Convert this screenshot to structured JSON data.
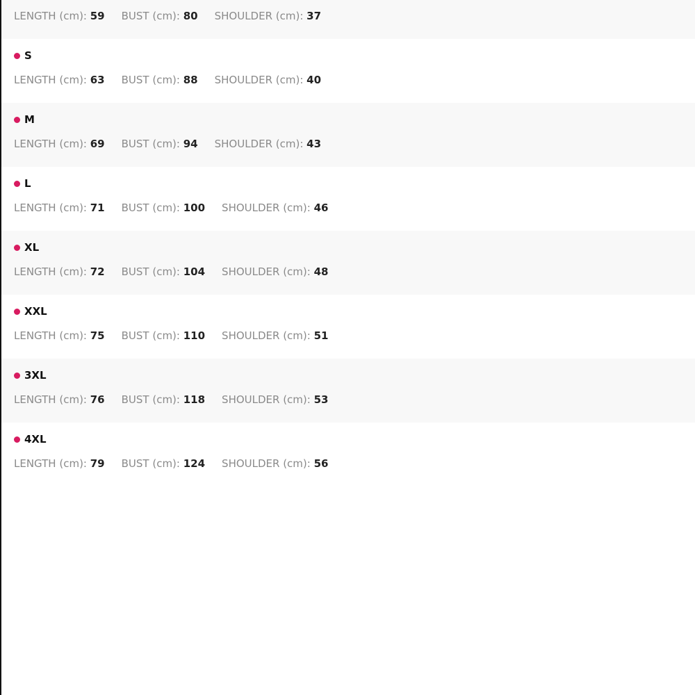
{
  "accent_color": "#d81b60",
  "labels": {
    "length": "LENGTH (cm): ",
    "bust": "BUST (cm): ",
    "shoulder": "SHOULDER (cm): "
  },
  "sizes": [
    {
      "name": "",
      "length": "59",
      "bust": "80",
      "shoulder": "37"
    },
    {
      "name": "S",
      "length": "63",
      "bust": "88",
      "shoulder": "40"
    },
    {
      "name": "M",
      "length": "69",
      "bust": "94",
      "shoulder": "43"
    },
    {
      "name": "L",
      "length": "71",
      "bust": "100",
      "shoulder": "46"
    },
    {
      "name": "XL",
      "length": "72",
      "bust": "104",
      "shoulder": "48"
    },
    {
      "name": "XXL",
      "length": "75",
      "bust": "110",
      "shoulder": "51"
    },
    {
      "name": "3XL",
      "length": "76",
      "bust": "118",
      "shoulder": "53"
    },
    {
      "name": "4XL",
      "length": "79",
      "bust": "124",
      "shoulder": "56"
    }
  ]
}
